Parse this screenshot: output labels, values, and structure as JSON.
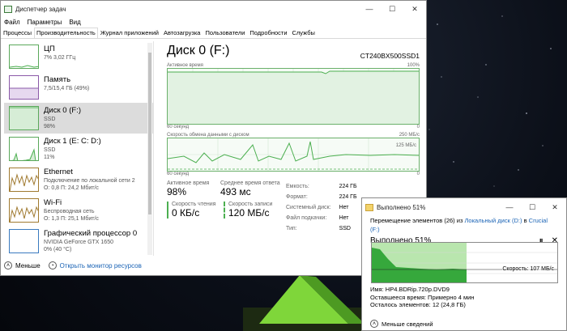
{
  "taskmanager": {
    "title": "Диспетчер задач",
    "menu": [
      "Файл",
      "Параметры",
      "Вид"
    ],
    "tabs": [
      "Процессы",
      "Производительность",
      "Журнал приложений",
      "Автозагрузка",
      "Пользователи",
      "Подробности",
      "Службы"
    ],
    "active_tab_index": 1,
    "sidebar": [
      {
        "name": "ЦП",
        "line1": "7% 3,02 ГГц",
        "line2": "",
        "line3": ""
      },
      {
        "name": "Память",
        "line1": "7,5/15,4 ГБ (49%)",
        "line2": "",
        "line3": ""
      },
      {
        "name": "Диск 0 (F:)",
        "line1": "SSD",
        "line2": "98%",
        "line3": ""
      },
      {
        "name": "Диск 1 (E: C: D:)",
        "line1": "SSD",
        "line2": "11%",
        "line3": ""
      },
      {
        "name": "Ethernet",
        "line1": "Подключение по локальной сети 2",
        "line2": "О: 0,8  П: 24,2 Мбит/с",
        "line3": ""
      },
      {
        "name": "Wi-Fi",
        "line1": "Беспроводная сеть",
        "line2": "О: 1,3  П: 25,1 Мбит/с",
        "line3": ""
      },
      {
        "name": "Графический процессор 0",
        "line1": "NVIDIA GeForce GTX 1650",
        "line2": "0% (40 °C)",
        "line3": ""
      }
    ],
    "bottom": {
      "less": "Меньше",
      "monitor": "Открыть монитор ресурсов"
    },
    "detail": {
      "title": "Диск 0 (F:)",
      "model": "CT240BX500SSD1",
      "graph1_label": "Активное время",
      "graph1_max": "100%",
      "graph1_left": "60 секунд",
      "graph1_right": "0",
      "graph2_label": "Скорость обмена данными с диском",
      "graph2_max": "250 МБ/с",
      "graph2_mid": "125 МБ/с",
      "graph2_left": "60 секунд",
      "graph2_right": "0",
      "active_time_label": "Активное время",
      "active_time": "98%",
      "response_label": "Среднее время ответа",
      "response": "493 мс",
      "read_label": "Скорость чтения",
      "read": "0 КБ/с",
      "write_label": "Скорость записи",
      "write": "120 МБ/с",
      "props": [
        {
          "k": "Емкость:",
          "v": "224 ГБ"
        },
        {
          "k": "Формат:",
          "v": "224 ГБ"
        },
        {
          "k": "Системный диск:",
          "v": "Нет"
        },
        {
          "k": "Файл подкачки:",
          "v": "Нет"
        },
        {
          "k": "Тип:",
          "v": "SSD"
        }
      ]
    }
  },
  "copydialog": {
    "title": "Выполнено 51%",
    "move_prefix": "Перемещение элементов (26) из",
    "from": "Локальный диск (D:)",
    "to_word": "в",
    "to": "Crucial (F:)",
    "progress_text": "Выполнено 51%",
    "progress": 51,
    "speed": "Скорость: 107 МБ/с",
    "name_line": "Имя: HP4.BDRip.720p.DVD9",
    "time_line": "Оставшееся время: Примерно 4 мин",
    "items_line": "Осталось элементов: 12 (24,8 ГБ)",
    "less": "Меньше сведений",
    "controls": [
      "⏸",
      "✕"
    ]
  },
  "colors": {
    "disk": "#4caf50",
    "mem": "#8b5aa8",
    "net": "#a07a30",
    "gpu": "#3a7abf"
  }
}
